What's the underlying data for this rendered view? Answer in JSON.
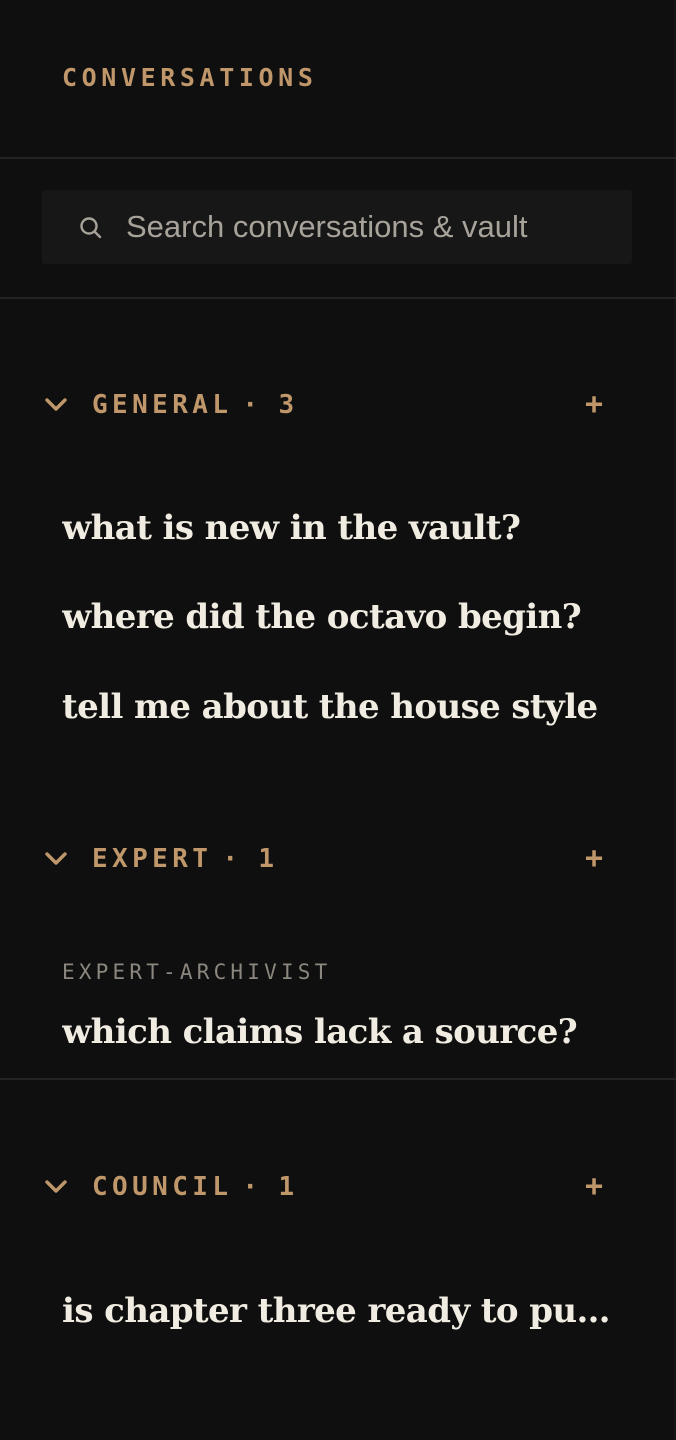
{
  "header": {
    "title": "CONVERSATIONS"
  },
  "search": {
    "placeholder": "Search conversations & vault",
    "icon": "search-icon"
  },
  "colors": {
    "background": "#0f0f0f",
    "accent": "#c0976a",
    "text": "#f1ece2",
    "muted": "#8b867e",
    "divider": "#232323"
  },
  "groups": [
    {
      "label": "GENERAL",
      "separator": "·",
      "count": "3",
      "add_label": "+",
      "items": [
        {
          "title": "what is new in the vault?"
        },
        {
          "title": "where did the octavo begin?"
        },
        {
          "title": "tell me about the house style"
        }
      ]
    },
    {
      "label": "EXPERT",
      "separator": "·",
      "count": "1",
      "add_label": "+",
      "items": [
        {
          "meta": "EXPERT-ARCHIVIST",
          "title": "which claims lack a source?"
        }
      ]
    },
    {
      "label": "COUNCIL",
      "separator": "·",
      "count": "1",
      "add_label": "+",
      "items": [
        {
          "title": "is chapter three ready to publ..."
        }
      ]
    }
  ]
}
